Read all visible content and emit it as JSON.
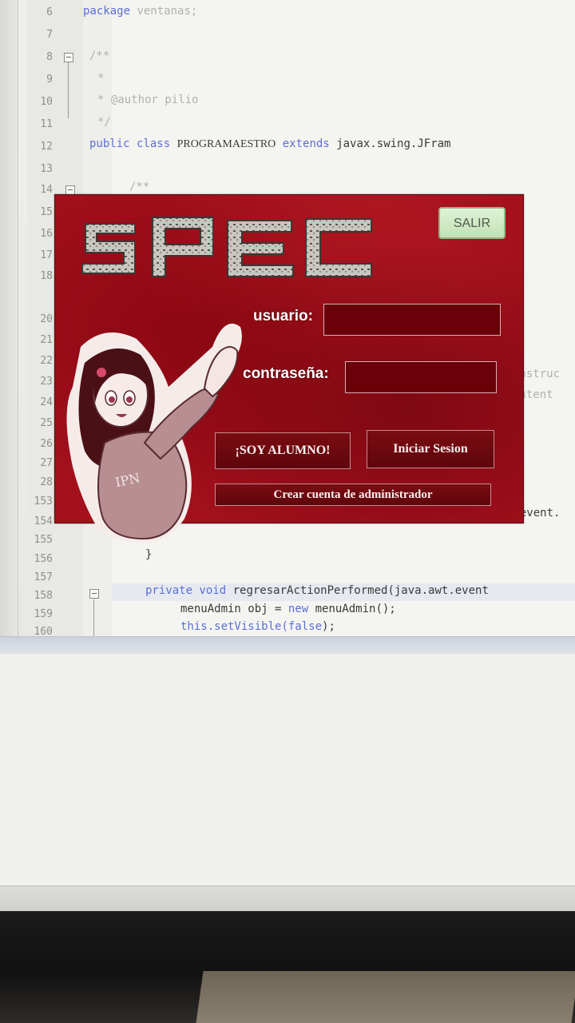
{
  "ide": {
    "line_numbers": [
      "6",
      "7",
      "8",
      "9",
      "10",
      "11",
      "12",
      "13",
      "14",
      "15",
      "16",
      "17",
      "18",
      "20",
      "21",
      "22",
      "23",
      "24",
      "25",
      "26",
      "27",
      "28",
      "153",
      "154",
      "155",
      "156",
      "157",
      "158",
      "159",
      "160"
    ],
    "code": {
      "pkg_kw": "package",
      "pkg_name": "ventanas;",
      "doc_open": "/**",
      "doc_star": "*",
      "author": "* @author pilio",
      "doc_close": "*/",
      "class_kw": "public class",
      "class_name": "PROGRAMAESTRO",
      "extends_kw": "extends",
      "extends_type": "javax.swing.JFram",
      "doc_open2": "/**",
      "right_constructor": "onstruc",
      "right_content": "ontent",
      "right_event": "t.event.",
      "brace": "}",
      "method_kw": "private void",
      "method_sig": "regresarActionPerformed(java.awt.event",
      "line159_a": "menuAdmin obj = ",
      "line159_new": "new",
      "line159_b": " menuAdmin();",
      "line160_a": "this.setVisible(",
      "line160_false": "false",
      "line160_b": ");"
    }
  },
  "dialog": {
    "logo_text": "SPEC",
    "exit_label": "SALIR",
    "user_label": "usuario:",
    "user_value": "",
    "password_label": "contraseña:",
    "password_value": "",
    "student_button": "¡SOY ALUMNO!",
    "login_button": "Iniciar Sesion",
    "create_admin_button": "Crear cuenta de administrador",
    "mascot_text": "IPN"
  },
  "colors": {
    "dialog_bg": "#a3101c",
    "field_bg": "#6a0008",
    "exit_bg": "#c2e1b6",
    "keyword": "#5b6fd6"
  }
}
